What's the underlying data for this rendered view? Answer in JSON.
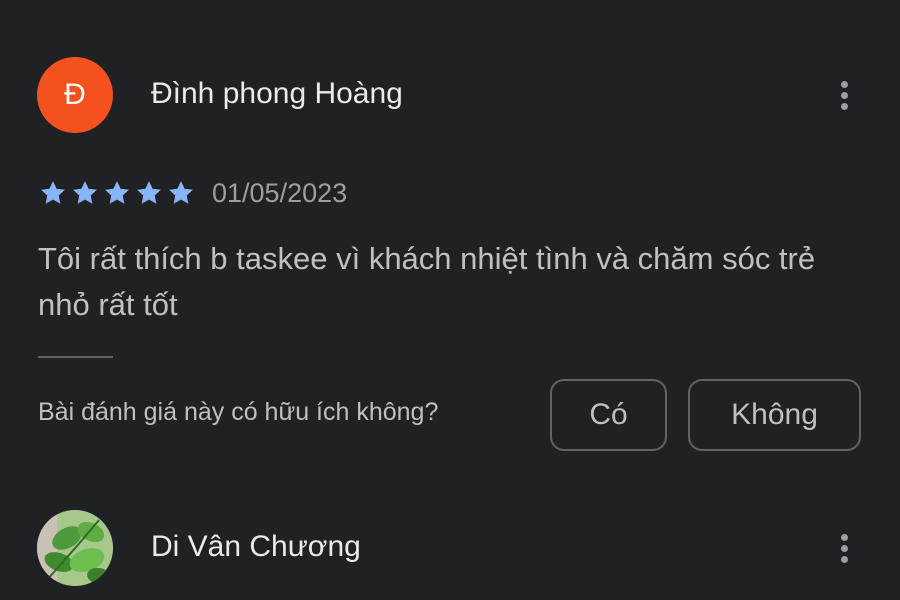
{
  "reviews": [
    {
      "author_initial": "Đ",
      "author_name": "Đình phong Hoàng",
      "avatar_color": "#f4511e",
      "rating": 5,
      "rating_max": 5,
      "star_color": "#8ab4f8",
      "date": "01/05/2023",
      "text": "Tôi rất thích b taskee vì khách nhiệt tình và chăm sóc trẻ nhỏ rất tốt",
      "helpful": {
        "question": "Bài đánh giá này có hữu ích không?",
        "yes_label": "Có",
        "no_label": "Không"
      },
      "more_icon": "more-vert-icon"
    },
    {
      "author_name": "Di Vân Chương",
      "avatar_type": "photo-leaves",
      "more_icon": "more-vert-icon"
    }
  ]
}
